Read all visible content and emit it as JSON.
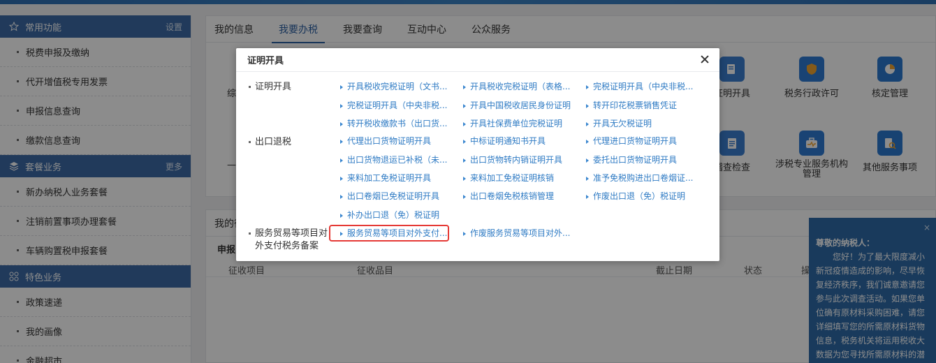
{
  "sidebar": {
    "common": {
      "title": "常用功能",
      "action": "设置"
    },
    "common_items": [
      "税费申报及缴纳",
      "代开增值税专用发票",
      "申报信息查询",
      "缴款信息查询"
    ],
    "package": {
      "title": "套餐业务",
      "action": "更多"
    },
    "package_items": [
      "新办纳税人业务套餐",
      "注销前置事项办理套餐",
      "车辆购置税申报套餐"
    ],
    "special": {
      "title": "特色业务"
    },
    "special_items": [
      "政策速递",
      "我的画像",
      "金融超市"
    ]
  },
  "tabs": [
    "我的信息",
    "我要办税",
    "我要查询",
    "互动中心",
    "公众服务"
  ],
  "active_tab": "我要办税",
  "tiles": [
    {
      "label": "证明开具"
    },
    {
      "label": "税务行政许可"
    },
    {
      "label": "核定管理"
    },
    {
      "label": "稽查检查"
    },
    {
      "label": "涉税专业服务机构管理"
    },
    {
      "label": "其他服务事项"
    }
  ],
  "partial_texts": {
    "left1": "综",
    "left2": "—"
  },
  "bottom_panel": {
    "tab_partial": "我的待",
    "sub_partial": "申报",
    "columns": [
      "征收项目",
      "征收品目",
      "截止日期",
      "状态",
      "操"
    ]
  },
  "notice": {
    "close": "×",
    "title": "尊敬的纳税人：",
    "body": "您好！为了最大限度减小新冠疫情造成的影响，尽早恢复经济秩序，我们诚意邀请您参与此次调查活动。如果您单位确有原材料采购困难，请您详细填写您的所需原材料货物信息，税务机关将运用税收大数据为您寻找所需原材料的潜在供应商，助力企"
  },
  "modal": {
    "title": "证明开具",
    "categories": [
      "证明开具",
      "出口退税",
      "服务贸易等项目对外支付税务备案"
    ],
    "sections": [
      {
        "links": [
          "开具税收完税证明（文书...",
          "开具税收完税证明（表格...",
          "完税证明开具（中央非税...",
          "完税证明开具（中央非税...",
          "开具中国税收居民身份证明",
          "转开印花税票销售凭证",
          "转开税收缴款书（出口货...",
          "开具社保费单位完税证明",
          "开具无欠税证明"
        ]
      },
      {
        "links": [
          "代理出口货物证明开具",
          "中标证明通知书开具",
          "代理进口货物证明开具",
          "出口货物退运已补税（未...",
          "出口货物转内销证明开具",
          "委托出口货物证明开具",
          "来料加工免税证明开具",
          "来料加工免税证明核销",
          "准予免税购进出口卷烟证...",
          "出口卷烟已免税证明开具",
          "出口卷烟免税核销管理",
          "作废出口退（免）税证明",
          "补办出口退（免）税证明"
        ]
      },
      {
        "links": [
          "服务贸易等项目对外支付...",
          "作废服务贸易等项目对外..."
        ]
      }
    ]
  }
}
